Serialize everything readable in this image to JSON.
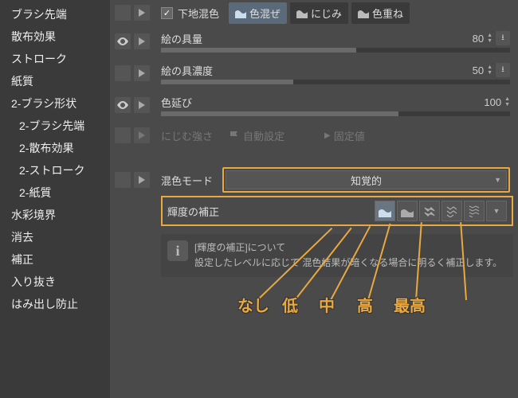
{
  "sidebar": {
    "items": [
      {
        "label": "ブラシ先端"
      },
      {
        "label": "散布効果"
      },
      {
        "label": "ストローク"
      },
      {
        "label": "紙質"
      },
      {
        "label": "2-ブラシ形状"
      },
      {
        "label": "2-ブラシ先端"
      },
      {
        "label": "2-散布効果"
      },
      {
        "label": "2-ストローク"
      },
      {
        "label": "2-紙質"
      },
      {
        "label": "水彩境界"
      },
      {
        "label": "消去"
      },
      {
        "label": "補正"
      },
      {
        "label": "入り抜き"
      },
      {
        "label": "はみ出し防止"
      }
    ]
  },
  "topcheck": {
    "label": "下地混色"
  },
  "modes": [
    {
      "label": "色混ぜ",
      "selected": true
    },
    {
      "label": "にじみ",
      "selected": false
    },
    {
      "label": "色重ね",
      "selected": false
    }
  ],
  "sliders": {
    "paint": {
      "label": "絵の具量",
      "value": "80",
      "fill": 56
    },
    "density": {
      "label": "絵の具濃度",
      "value": "50",
      "fill": 38
    },
    "spread": {
      "label": "色延び",
      "value": "100",
      "fill": 68
    }
  },
  "bleed": {
    "label": "にじむ強さ",
    "auto": "自動設定",
    "fixed": "固定値"
  },
  "mix": {
    "label": "混色モード",
    "value": "知覚的"
  },
  "lum": {
    "label": "輝度の補正"
  },
  "info": {
    "title": "[輝度の補正]について",
    "body": "設定したレベルに応じて 混色結果が暗くなる場合に明るく補正します。"
  },
  "annotations": [
    "なし",
    "低",
    "中",
    "高",
    "最高"
  ],
  "colors": {
    "highlight": "#e9a840",
    "panel": "#3a3a3a",
    "bg": "#4a4a4a"
  }
}
